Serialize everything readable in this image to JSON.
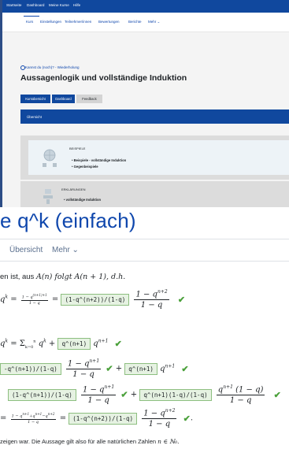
{
  "nav": {
    "links": [
      "Startseite",
      "Dashboard",
      "Meine Kurse",
      "Hilfe"
    ]
  },
  "secondary_nav": {
    "items": [
      "Kurs",
      "Einstellungen",
      "Teilnehmer/innen",
      "Bewertungen",
      "Berichte",
      "Mehr ⌄"
    ]
  },
  "course": {
    "breadcrumb": "Kannst du (noch)? - Wiederholung",
    "title": "Aussagenlogik und vollständige Induktion",
    "buttons": [
      "Kursübersicht",
      "Dashboard",
      "Feedback"
    ],
    "overview": "Übersicht",
    "sections": [
      {
        "title": "BEISPIELE",
        "items": [
          "Beispiele - vollständige Induktion",
          "Gegenbeispiele"
        ]
      },
      {
        "title": "ERKLÄRUNGEN",
        "items": [
          "vollständige Induktion"
        ]
      }
    ]
  },
  "page": {
    "title": "e q^k (einfach)",
    "tabs": [
      "Übersicht",
      "Mehr ⌄"
    ]
  },
  "content": {
    "intro_text": "en ist, aus",
    "intro_math": "A(n) folgt A(n + 1), d.h.",
    "answers": [
      "(1-q^(n+2))/(1-q)",
      "q^(n+1)",
      "-q^(n+1))/(1-q)",
      "q^(n+1)",
      "(1-q^(n+1))/(1-q)",
      "q^(n+1)(1-q)/(1-q)",
      "(1-q^(n+2))/(1-q)"
    ],
    "conclusion": "zeigen war. Die Aussage gilt also für alle natürlichen Zahlen",
    "conclusion_math": "n ∈ ℕ₀."
  },
  "colors": {
    "brand_blue": "#10489e",
    "link_blue": "#0f47ad",
    "correct_green": "#4aa03a"
  }
}
